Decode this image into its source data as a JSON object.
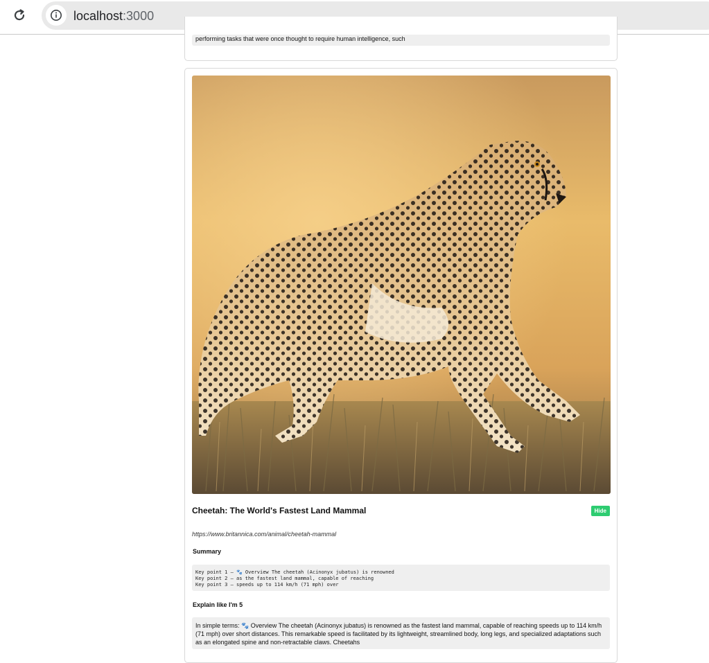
{
  "browser": {
    "url_host": "localhost",
    "url_port": ":3000"
  },
  "previous_card": {
    "text": "performing tasks that were once thought to require human intelligence, such"
  },
  "article": {
    "image_alt": "cheetah walking through golden savanna grass",
    "title": "Cheetah: The World's Fastest Land Mammal",
    "hide_label": "Hide",
    "source_url": "https://www.britannica.com/animal/cheetah-mammal",
    "summary_label": "Summary",
    "summary_lines": [
      "Key point 1 — 🐾 Overview The cheetah (Acinonyx jubatus) is renowned",
      "Key point 2 — as the fastest land mammal, capable of reaching",
      "Key point 3 — speeds up to 114 km/h (71 mph) over"
    ],
    "eli5_label": "Explain like I'm 5",
    "eli5_text": "In simple terms: 🐾 Overview The cheetah (Acinonyx jubatus) is renowned as the fastest land mammal, capable of reaching speeds up to 114 km/h (71 mph) over short distances. This remarkable speed is facilitated by its lightweight, streamlined body, long legs, and specialized adaptations such as an elongated spine and non-retractable claws. Cheetahs"
  },
  "colors": {
    "hide_button": "#2ecc71",
    "box_background": "#efefef"
  }
}
